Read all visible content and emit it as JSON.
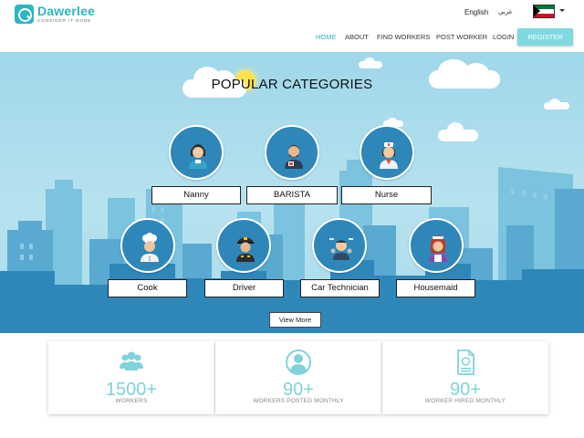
{
  "brand": {
    "name": "Dawerlee",
    "tagline": "CONSIDER IT DONE",
    "color": "#2bb6c2"
  },
  "language": {
    "english_label": "English",
    "arabic_label": "عربي",
    "flag_icon": "kuwait-flag-icon"
  },
  "nav": {
    "items": [
      {
        "label": "HOME",
        "active": true
      },
      {
        "label": "ABOUT",
        "active": false
      },
      {
        "label": "FIND WORKERS",
        "active": false
      },
      {
        "label": "POST WORKER",
        "active": false
      },
      {
        "label": "LOGIN",
        "active": false
      }
    ],
    "register_label": "REGISTER"
  },
  "hero": {
    "title": "POPULAR CATEGORIES",
    "categories": [
      {
        "label": "Nanny",
        "icon": "nanny-icon"
      },
      {
        "label": "BARISTA",
        "icon": "barista-icon"
      },
      {
        "label": "Nurse",
        "icon": "nurse-icon"
      },
      {
        "label": "Cook",
        "icon": "cook-icon"
      },
      {
        "label": "Driver",
        "icon": "driver-icon"
      },
      {
        "label": "Car Technician",
        "icon": "car-technician-icon"
      },
      {
        "label": "Housemaid",
        "icon": "housemaid-icon"
      }
    ],
    "view_more_label": "View More"
  },
  "stats": [
    {
      "value": "1500+",
      "label": "WORKERS",
      "icon": "users-group-icon"
    },
    {
      "value": "90+",
      "label": "WORKERS POSTED MONTHLY",
      "icon": "user-circle-icon"
    },
    {
      "value": "90+",
      "label": "WORKER HIRED MONTHLY",
      "icon": "document-certificate-icon"
    }
  ],
  "colors": {
    "accent": "#2bb6c2",
    "register_button": "#7fd9df",
    "stat_value": "#7fd3da",
    "sky": "#a9dbec",
    "buildings": "#2e87b8"
  }
}
